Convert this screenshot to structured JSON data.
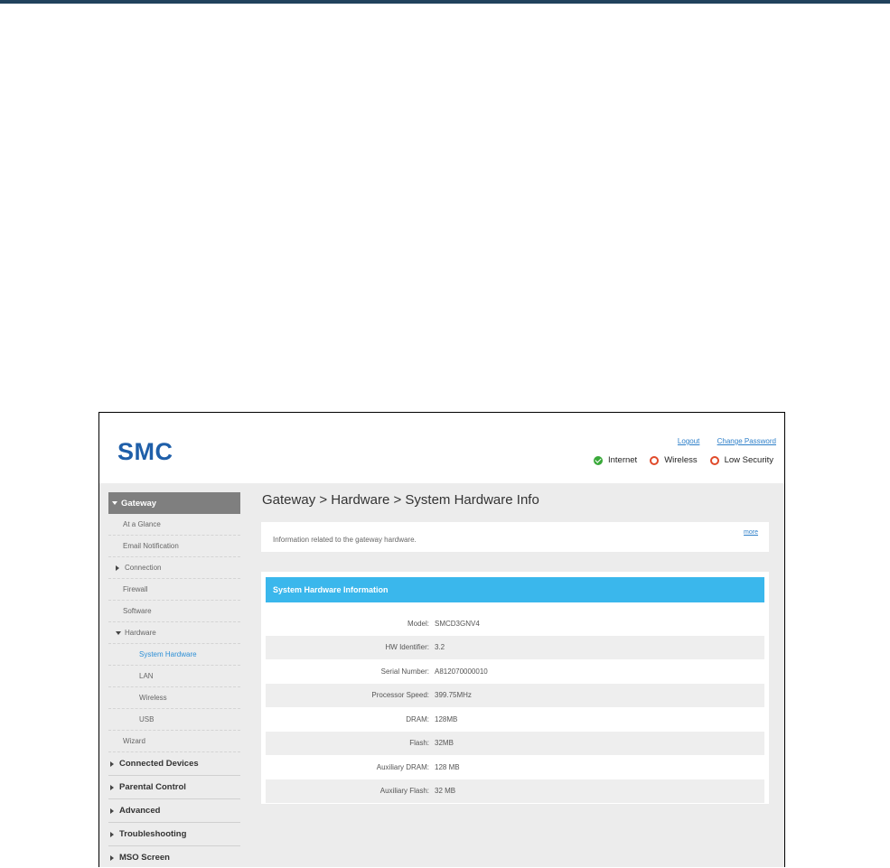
{
  "brand": {
    "logo_text": "SMC"
  },
  "header": {
    "logout": "Logout",
    "change_password": "Change Password",
    "status": [
      {
        "label": "Internet",
        "state": "ok",
        "icon": "check-circle-icon",
        "color": "#3aa93a"
      },
      {
        "label": "Wireless",
        "state": "warn",
        "icon": "lifebuoy-icon",
        "color": "#e04a2a"
      },
      {
        "label": "Low Security",
        "state": "warn",
        "icon": "lifebuoy-icon",
        "color": "#e04a2a"
      }
    ]
  },
  "sidebar": {
    "gateway": "Gateway",
    "items": {
      "at_a_glance": "At a Glance",
      "email_notification": "Email Notification",
      "connection": "Connection",
      "firewall": "Firewall",
      "software": "Software",
      "hardware": "Hardware",
      "system_hardware": "System Hardware",
      "lan": "LAN",
      "wireless": "Wireless",
      "usb": "USB",
      "wizard": "Wizard"
    },
    "sections": [
      "Connected Devices",
      "Parental Control",
      "Advanced",
      "Troubleshooting",
      "MSO Screen"
    ]
  },
  "main": {
    "title": "Gateway > Hardware > System Hardware Info",
    "info_text": "Information related to the gateway hardware.",
    "more_link": "more",
    "panel_title": "System Hardware Information",
    "rows": [
      {
        "label": "Model:",
        "value": "SMCD3GNV4"
      },
      {
        "label": "HW Identifier:",
        "value": "3.2"
      },
      {
        "label": "Serial Number:",
        "value": "A812070000010"
      },
      {
        "label": "Processor Speed:",
        "value": "399.75MHz"
      },
      {
        "label": "DRAM:",
        "value": "128MB"
      },
      {
        "label": "Flash:",
        "value": "32MB"
      },
      {
        "label": "Auxiliary DRAM:",
        "value": "128 MB"
      },
      {
        "label": "Auxiliary Flash:",
        "value": "32 MB"
      }
    ]
  }
}
